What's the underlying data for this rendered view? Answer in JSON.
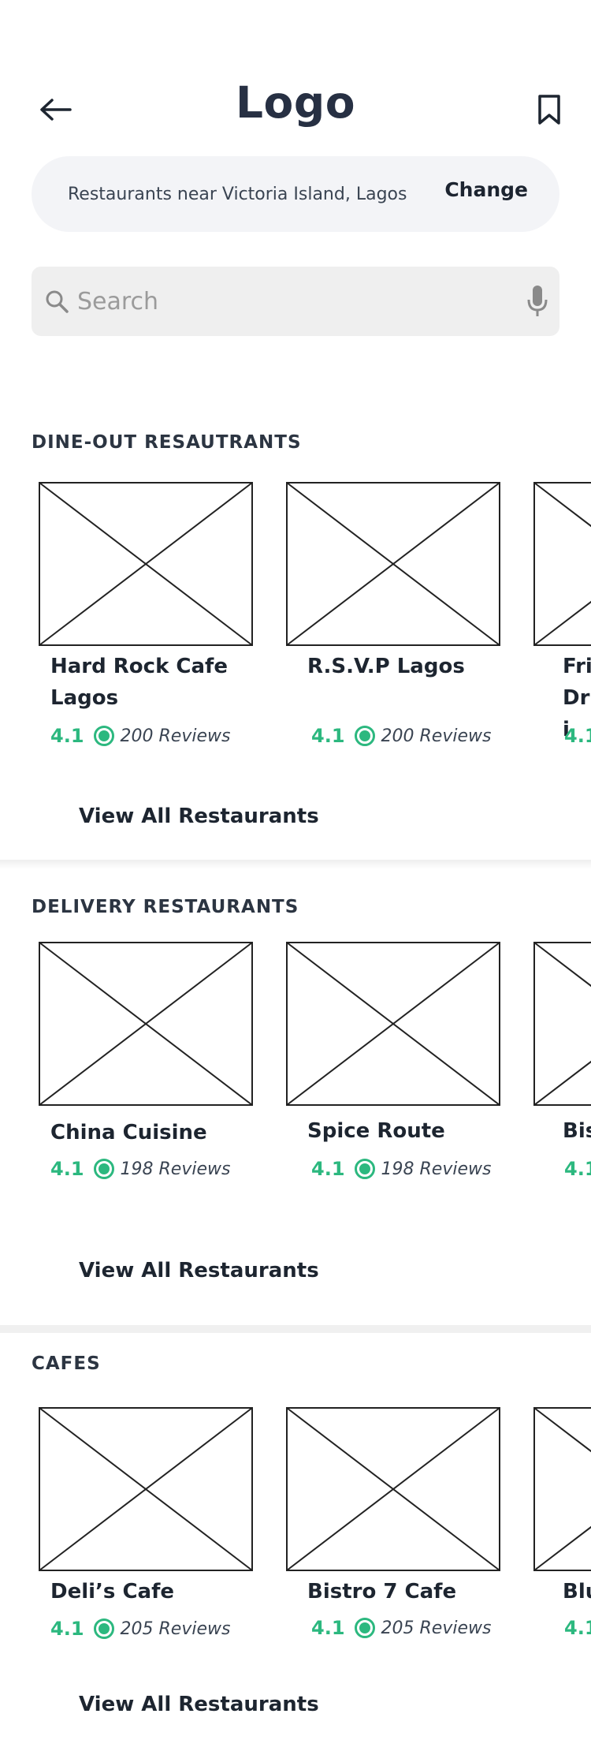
{
  "header": {
    "logo": "Logo",
    "back_icon": "arrow-left-icon",
    "bookmark_icon": "bookmark-icon"
  },
  "location": {
    "text": "Restaurants near Victoria Island, Lagos",
    "change_label": "Change"
  },
  "search": {
    "placeholder": "Search",
    "value": "",
    "search_icon": "search-icon",
    "mic_icon": "microphone-icon"
  },
  "colors": {
    "accent_green": "#2cb87f",
    "text_dark": "#1d2530",
    "surface": "#f3f4f7"
  },
  "sections": [
    {
      "title": "DINE-OUT RESAUTRANTS",
      "view_all": "View All Restaurants",
      "cards": [
        {
          "name": "Hard Rock Cafe Lagos",
          "rating": "4.1",
          "reviews": "200 Reviews"
        },
        {
          "name": "R.S.V.P Lagos",
          "rating": "4.1",
          "reviews": "200 Reviews"
        },
        {
          "name": "Fri Dri",
          "rating": "4.1",
          "reviews": ""
        }
      ]
    },
    {
      "title": "DELIVERY RESTAURANTS",
      "view_all": "View All Restaurants",
      "cards": [
        {
          "name": "China Cuisine",
          "rating": "4.1",
          "reviews": "198 Reviews"
        },
        {
          "name": "Spice Route",
          "rating": "4.1",
          "reviews": "198 Reviews"
        },
        {
          "name": "Bis",
          "rating": "4.1",
          "reviews": ""
        }
      ]
    },
    {
      "title": "CAFES",
      "view_all": "View All Restaurants",
      "cards": [
        {
          "name": "Deli’s Cafe",
          "rating": "4.1",
          "reviews": "205 Reviews"
        },
        {
          "name": "Bistro 7 Cafe",
          "rating": "4.1",
          "reviews": "205 Reviews"
        },
        {
          "name": "Blu",
          "rating": "4.1",
          "reviews": ""
        }
      ]
    }
  ]
}
